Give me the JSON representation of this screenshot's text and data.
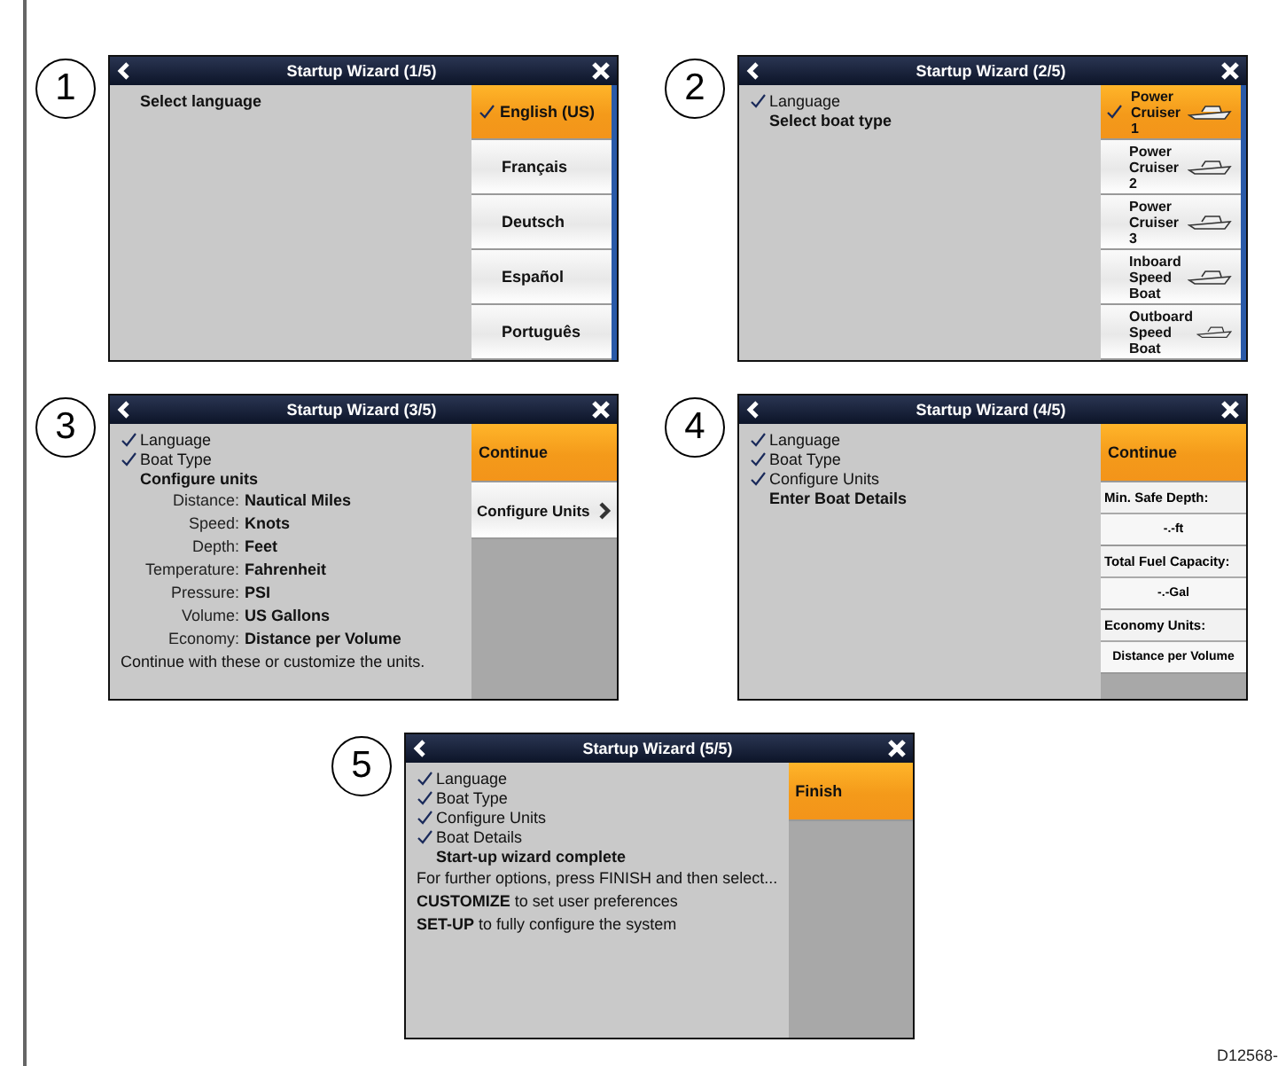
{
  "panels": [
    {
      "number": "1",
      "title": "Startup Wizard (1/5)",
      "scrollable": true,
      "lines": [
        {
          "kind": "current",
          "text": "Select language"
        }
      ],
      "menu": [
        {
          "kind": "option",
          "label": "English (US)",
          "selected": true
        },
        {
          "kind": "option",
          "label": "Français",
          "selected": false
        },
        {
          "kind": "option",
          "label": "Deutsch",
          "selected": false
        },
        {
          "kind": "option",
          "label": "Español",
          "selected": false
        },
        {
          "kind": "option",
          "label": "Português",
          "selected": false
        }
      ]
    },
    {
      "number": "2",
      "title": "Startup Wizard (2/5)",
      "scrollable": true,
      "lines": [
        {
          "kind": "done",
          "text": "Language"
        },
        {
          "kind": "current",
          "text": "Select boat type"
        }
      ],
      "menu": [
        {
          "kind": "boat",
          "label": "Power Cruiser 1",
          "selected": true
        },
        {
          "kind": "boat",
          "label": "Power Cruiser 2",
          "selected": false
        },
        {
          "kind": "boat",
          "label": "Power Cruiser 3",
          "selected": false
        },
        {
          "kind": "boat",
          "label": "Inboard Speed Boat",
          "selected": false
        },
        {
          "kind": "boat",
          "label": "Outboard Speed Boat",
          "selected": false
        }
      ]
    },
    {
      "number": "3",
      "title": "Startup Wizard (3/5)",
      "scrollable": false,
      "lines": [
        {
          "kind": "done",
          "text": "Language"
        },
        {
          "kind": "done",
          "text": "Boat Type"
        },
        {
          "kind": "current",
          "text": "Configure units"
        },
        {
          "kind": "unit",
          "label": "Distance:",
          "value": "Nautical Miles"
        },
        {
          "kind": "unit",
          "label": "Speed:",
          "value": "Knots"
        },
        {
          "kind": "unit",
          "label": "Depth:",
          "value": "Feet"
        },
        {
          "kind": "unit",
          "label": "Temperature:",
          "value": "Fahrenheit"
        },
        {
          "kind": "unit",
          "label": "Pressure:",
          "value": "PSI"
        },
        {
          "kind": "unit",
          "label": "Volume:",
          "value": "US Gallons"
        },
        {
          "kind": "unit",
          "label": "Economy:",
          "value": "Distance per Volume"
        },
        {
          "kind": "note",
          "text": "Continue with these or customize the units."
        }
      ],
      "menu": [
        {
          "kind": "action",
          "label": "Continue"
        },
        {
          "kind": "link",
          "label": "Configure Units"
        }
      ]
    },
    {
      "number": "4",
      "title": "Startup Wizard (4/5)",
      "scrollable": false,
      "lines": [
        {
          "kind": "done",
          "text": "Language"
        },
        {
          "kind": "done",
          "text": "Boat Type"
        },
        {
          "kind": "done",
          "text": "Configure Units"
        },
        {
          "kind": "current",
          "text": "Enter Boat Details"
        }
      ],
      "menu": [
        {
          "kind": "action",
          "label": "Continue"
        },
        {
          "kind": "label",
          "label": "Min. Safe Depth:"
        },
        {
          "kind": "value",
          "label": "-.-ft"
        },
        {
          "kind": "label",
          "label": "Total Fuel Capacity:"
        },
        {
          "kind": "value",
          "label": "-.-Gal"
        },
        {
          "kind": "label",
          "label": "Economy Units:"
        },
        {
          "kind": "value",
          "label": "Distance per Volume"
        }
      ]
    },
    {
      "number": "5",
      "title": "Startup Wizard (5/5)",
      "scrollable": false,
      "lines": [
        {
          "kind": "done",
          "text": "Language"
        },
        {
          "kind": "done",
          "text": "Boat Type"
        },
        {
          "kind": "done",
          "text": "Configure Units"
        },
        {
          "kind": "done",
          "text": "Boat Details"
        },
        {
          "kind": "current",
          "text": "Start-up wizard complete"
        },
        {
          "kind": "note",
          "text": "For further options, press FINISH and then select..."
        },
        {
          "kind": "note",
          "text": "**CUSTOMIZE** to set user preferences"
        },
        {
          "kind": "note",
          "text": "**SET-UP** to fully configure the system"
        }
      ],
      "menu": [
        {
          "kind": "action",
          "label": "Finish"
        }
      ]
    }
  ],
  "figure_code": "D12568-"
}
